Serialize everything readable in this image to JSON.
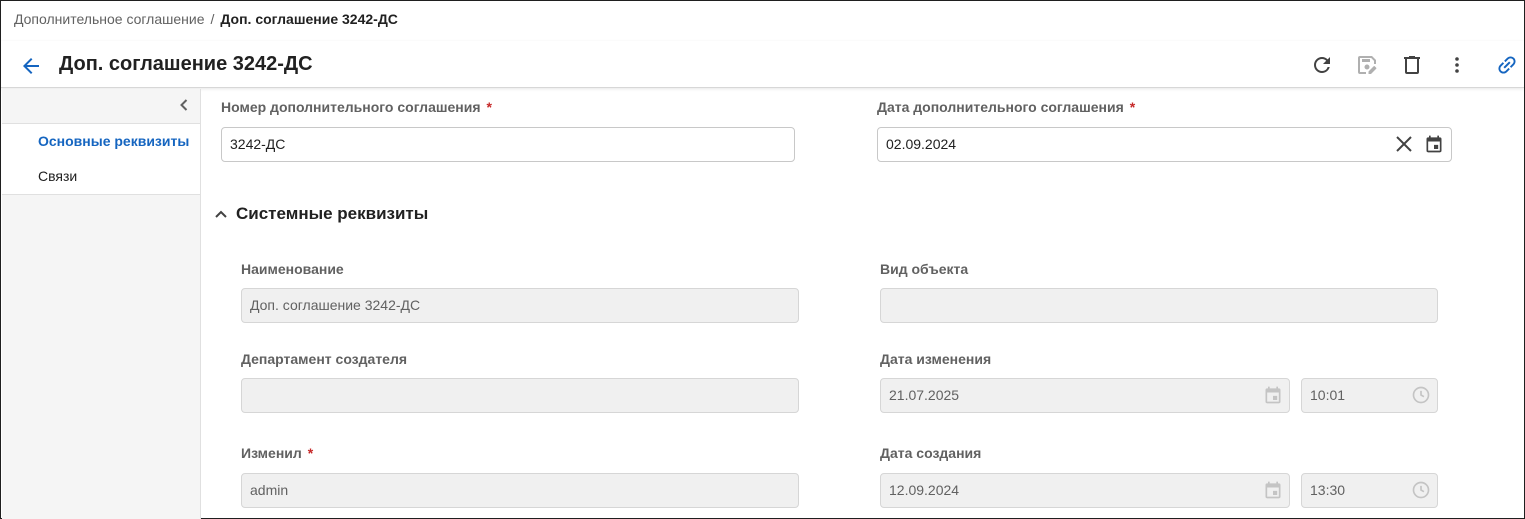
{
  "breadcrumb": {
    "parent": "Дополнительное соглашение",
    "separator": "/",
    "current": "Доп. соглашение 3242-ДС"
  },
  "header": {
    "title": "Доп. соглашение 3242-ДС",
    "icons": [
      "arrow-left-icon",
      "refresh-icon",
      "save-edit-icon",
      "delete-icon",
      "more-vert-icon",
      "link-icon"
    ]
  },
  "sidebar": {
    "items": [
      {
        "label": "Основные реквизиты",
        "active": true
      },
      {
        "label": "Связи",
        "active": false
      }
    ]
  },
  "main": {
    "agreement_number": {
      "label": "Номер дополнительного соглашения",
      "required_mark": "*",
      "value": "3242-ДС"
    },
    "agreement_date": {
      "label": "Дата дополнительного соглашения",
      "required_mark": "*",
      "value": "02.09.2024"
    },
    "system_section": {
      "title": "Системные реквизиты",
      "expanded": true,
      "name": {
        "label": "Наименование",
        "value": "Доп. соглашение 3242-ДС"
      },
      "object_type": {
        "label": "Вид объекта",
        "value": ""
      },
      "creator_department": {
        "label": "Департамент создателя",
        "value": ""
      },
      "modified_date": {
        "label": "Дата изменения",
        "date": "21.07.2025",
        "time": "10:01"
      },
      "modified_by": {
        "label": "Изменил",
        "required_mark": "*",
        "value": "admin"
      },
      "created_date": {
        "label": "Дата создания",
        "date": "12.09.2024",
        "time": "13:30"
      }
    }
  },
  "colors": {
    "accent": "#1565c0",
    "required": "#c62828",
    "readonly_bg": "#f0f0f0",
    "sidebar_bg": "#f5f5f5"
  }
}
